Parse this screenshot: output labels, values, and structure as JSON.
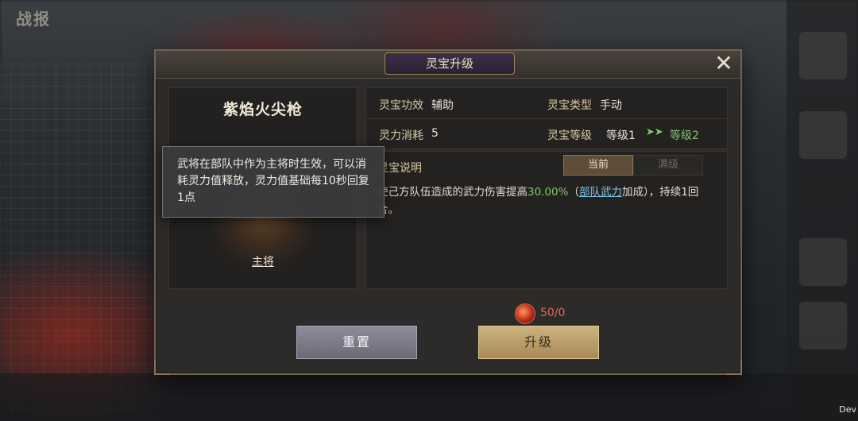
{
  "background": {
    "top_left_text": "战报",
    "corner_label": "Dev"
  },
  "dialog": {
    "title": "灵宝升级",
    "close_icon": "close-icon"
  },
  "item": {
    "name": "紫焰火尖枪",
    "role": "主将"
  },
  "info": {
    "effect_label": "灵宝功效",
    "effect_value": "辅助",
    "type_label": "灵宝类型",
    "type_value": "手动",
    "cost_label": "灵力消耗",
    "cost_value": "5",
    "level_label": "灵宝等级",
    "level_current": "等级1",
    "level_next": "等级2",
    "level_arrow_icon": "double-chevron-right-icon"
  },
  "description": {
    "title": "灵宝说明",
    "tab_current": "当前",
    "tab_max": "满级",
    "text_prefix": "使己方队伍造成的武力伤害提高",
    "text_value": "30.00%",
    "text_mid": "（",
    "text_link": "部队武力",
    "text_suffix": "加成），持续1回合。"
  },
  "tooltip": {
    "text": "武将在部队中作为主将时生效，可以消耗灵力值释放，灵力值基础每10秒回复1点"
  },
  "cost": {
    "icon": "spirit-orb-icon",
    "text": "50/0"
  },
  "buttons": {
    "reset": "重置",
    "upgrade": "升级"
  },
  "colors": {
    "accent_green": "#7ec76a",
    "link_blue": "#7fc8e8",
    "cost_red": "#e06a5a",
    "upgrade_gold": "#cbb381"
  }
}
